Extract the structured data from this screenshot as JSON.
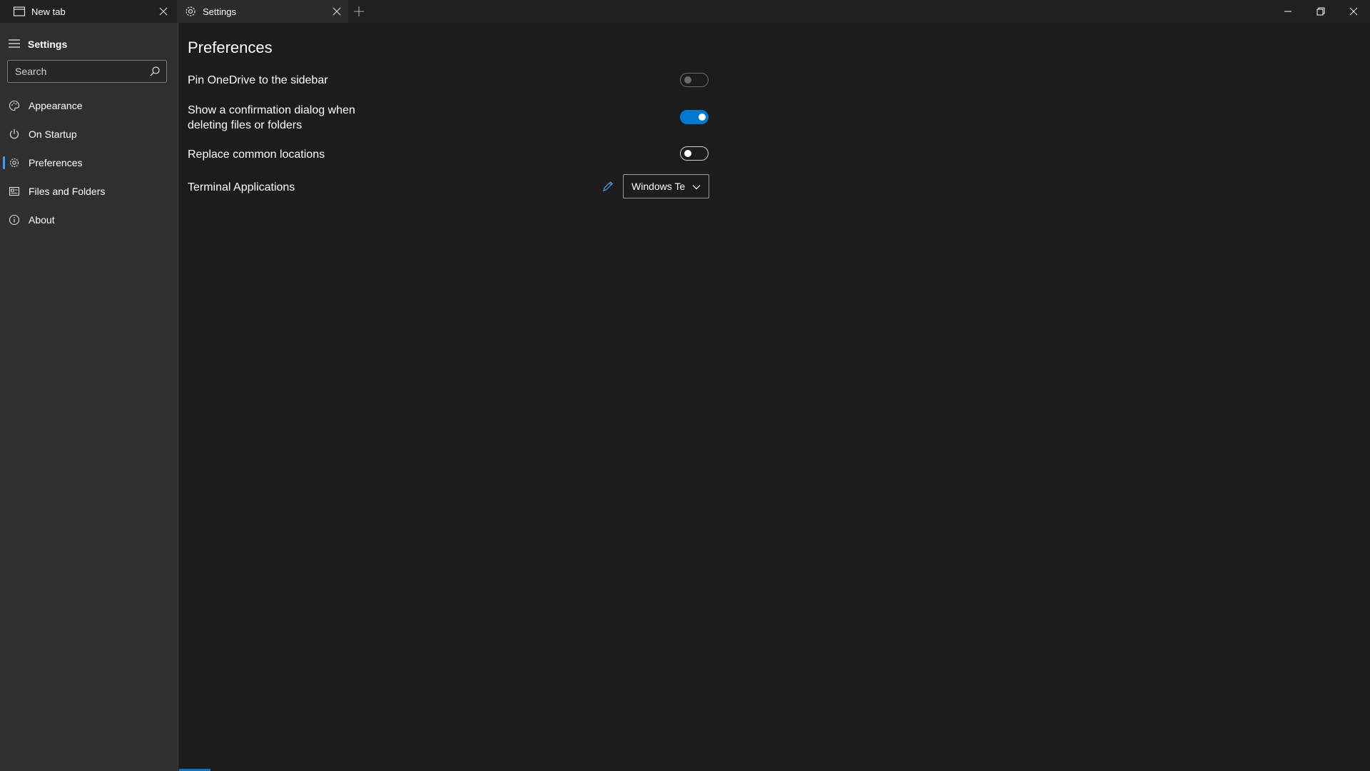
{
  "tabs": [
    {
      "label": "New tab",
      "icon": "window-icon",
      "active": false
    },
    {
      "label": "Settings",
      "icon": "gear-icon",
      "active": true
    }
  ],
  "sidebar": {
    "title": "Settings",
    "search": {
      "placeholder": "Search",
      "value": ""
    },
    "items": [
      {
        "label": "Appearance",
        "icon": "palette-icon",
        "selected": false
      },
      {
        "label": "On Startup",
        "icon": "power-icon",
        "selected": false
      },
      {
        "label": "Preferences",
        "icon": "gear-icon",
        "selected": true
      },
      {
        "label": "Files and Folders",
        "icon": "folder-list-icon",
        "selected": false
      },
      {
        "label": "About",
        "icon": "info-icon",
        "selected": false
      }
    ]
  },
  "main": {
    "title": "Preferences",
    "settings": [
      {
        "label": "Pin OneDrive to the sidebar",
        "enabled": false,
        "disabled_look": true
      },
      {
        "label_line1": "Show a confirmation dialog when",
        "label_line2": "deleting files or folders",
        "enabled": true
      },
      {
        "label": "Replace common locations",
        "enabled": false
      },
      {
        "label": "Terminal Applications",
        "selected_value": "Windows Terminal"
      }
    ]
  },
  "colors": {
    "accent": "#0078d4",
    "sidebar_bg": "#2f2f2f",
    "main_bg": "#1c1c1c",
    "titlebar_bg": "#202020"
  }
}
